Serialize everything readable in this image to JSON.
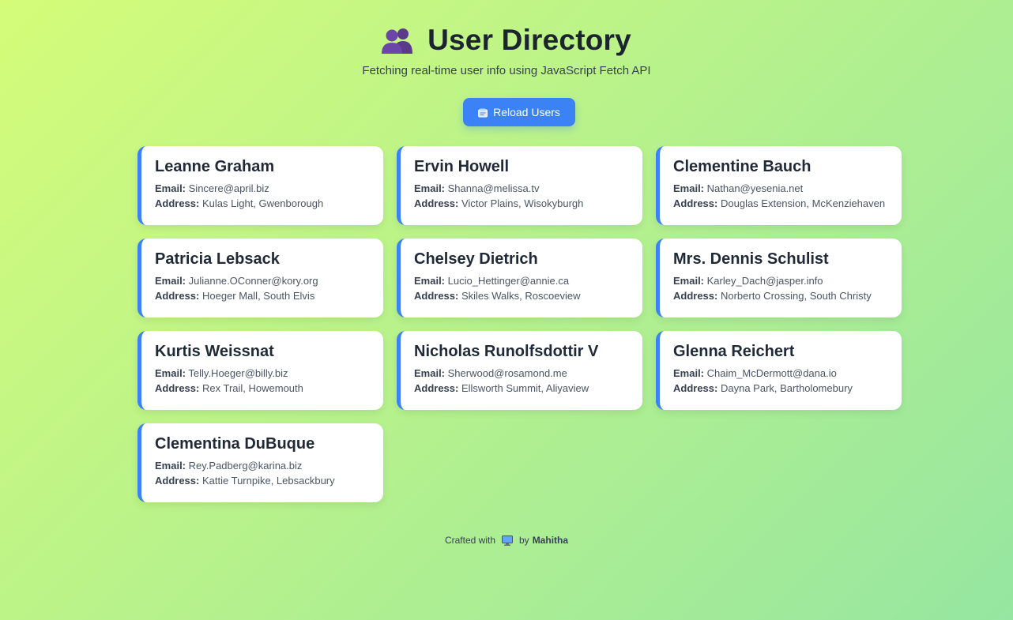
{
  "header": {
    "icon": "busts-in-silhouette-icon",
    "title": "User Directory",
    "subtitle": "Fetching real-time user info using JavaScript Fetch API"
  },
  "reload_button": {
    "icon": "card-file-icon",
    "label": "Reload Users"
  },
  "labels": {
    "email": "Email:",
    "address": "Address:"
  },
  "users": [
    {
      "name": "Leanne Graham",
      "email": "Sincere@april.biz",
      "address": "Kulas Light, Gwenborough"
    },
    {
      "name": "Ervin Howell",
      "email": "Shanna@melissa.tv",
      "address": "Victor Plains, Wisokyburgh"
    },
    {
      "name": "Clementine Bauch",
      "email": "Nathan@yesenia.net",
      "address": "Douglas Extension, McKenziehaven"
    },
    {
      "name": "Patricia Lebsack",
      "email": "Julianne.OConner@kory.org",
      "address": "Hoeger Mall, South Elvis"
    },
    {
      "name": "Chelsey Dietrich",
      "email": "Lucio_Hettinger@annie.ca",
      "address": "Skiles Walks, Roscoeview"
    },
    {
      "name": "Mrs. Dennis Schulist",
      "email": "Karley_Dach@jasper.info",
      "address": "Norberto Crossing, South Christy"
    },
    {
      "name": "Kurtis Weissnat",
      "email": "Telly.Hoeger@billy.biz",
      "address": "Rex Trail, Howemouth"
    },
    {
      "name": "Nicholas Runolfsdottir V",
      "email": "Sherwood@rosamond.me",
      "address": "Ellsworth Summit, Aliyaview"
    },
    {
      "name": "Glenna Reichert",
      "email": "Chaim_McDermott@dana.io",
      "address": "Dayna Park, Bartholomebury"
    },
    {
      "name": "Clementina DuBuque",
      "email": "Rey.Padberg@karina.biz",
      "address": "Kattie Turnpike, Lebsackbury"
    }
  ],
  "footer": {
    "prefix": "Crafted with",
    "icon": "desktop-computer-icon",
    "by": "by",
    "author": "Mahitha"
  },
  "colors": {
    "accent": "#3b82f6",
    "background_start": "#d4fc79",
    "background_end": "#96e6a1",
    "card": "#ffffff"
  }
}
